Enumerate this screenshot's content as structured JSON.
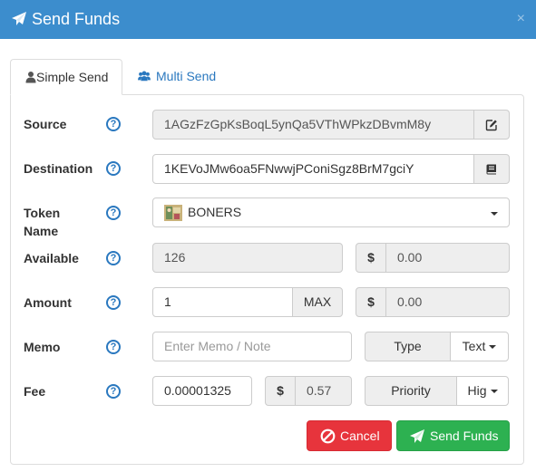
{
  "dialog": {
    "title": "Send Funds",
    "close_label": "×"
  },
  "tabs": [
    {
      "label": "Simple Send",
      "icon": "user-icon",
      "active": true
    },
    {
      "label": "Multi Send",
      "icon": "users-icon",
      "active": false
    }
  ],
  "help_label": "?",
  "fields": {
    "source": {
      "label": "Source",
      "value": "1AGzFzGpKsBoqL5ynQa5VThWPkzDBvmM8y",
      "button_icon": "edit-icon"
    },
    "destination": {
      "label": "Destination",
      "value": "1KEVoJMw6oa5FNwwjPConiSgz8BrM7gciY",
      "button_icon": "address-book-icon"
    },
    "token": {
      "label": "Token Name",
      "value": "BONERS",
      "icon": "token-icon"
    },
    "available": {
      "label": "Available",
      "value": "126",
      "currency_symbol": "$",
      "usd_value": "0.00"
    },
    "amount": {
      "label": "Amount",
      "value": "1",
      "max_label": "MAX",
      "currency_symbol": "$",
      "usd_value": "0.00"
    },
    "memo": {
      "label": "Memo",
      "placeholder": "Enter Memo / Note",
      "type_label": "Type",
      "type_value": "Text"
    },
    "fee": {
      "label": "Fee",
      "value": "0.00001325",
      "currency_symbol": "$",
      "usd_value": "0.57",
      "priority_label": "Priority",
      "priority_value": "Hig"
    }
  },
  "buttons": {
    "cancel": "Cancel",
    "send": "Send Funds"
  },
  "colors": {
    "titlebar": "#3c8dcd",
    "link": "#2a78bf",
    "cancel": "#e7343c",
    "send": "#2db151"
  }
}
